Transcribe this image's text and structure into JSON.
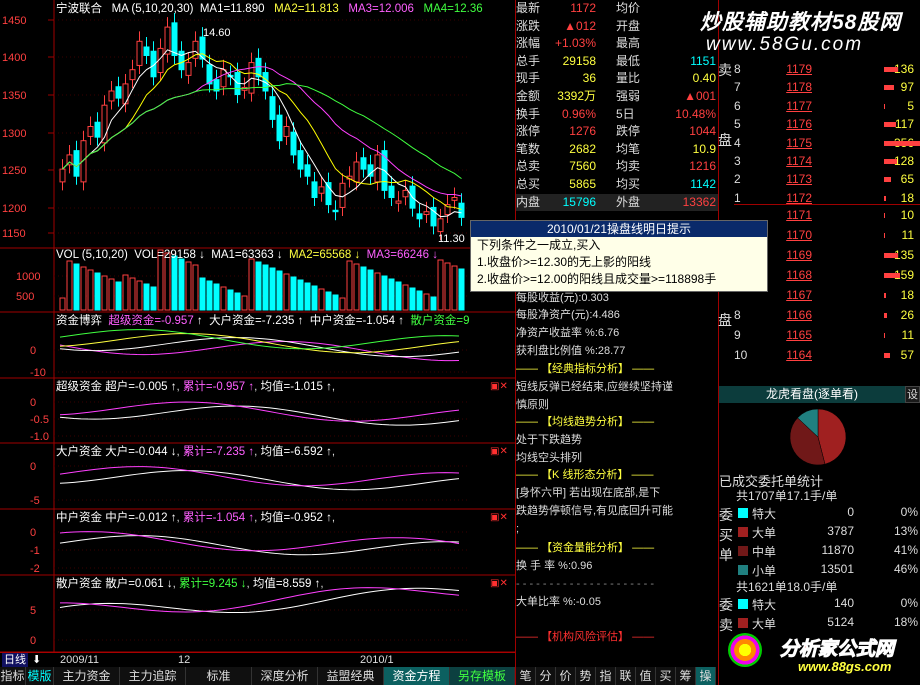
{
  "stock": {
    "name": "宁波联合"
  },
  "price_panel": {
    "ma_label": "MA (5,10,20,30)",
    "ma1": "MA1=11.890",
    "ma2": "MA2=11.813",
    "ma3": "MA3=12.006",
    "ma4": "MA4=12.36",
    "y_ticks": [
      "1450",
      "1400",
      "1350",
      "1300",
      "1250",
      "1200",
      "1150"
    ],
    "high_note": "14.60",
    "low_note": "11.30"
  },
  "volume_panel": {
    "label": "VOL (5,10,20)",
    "vol": "VOL=29158",
    "ma1": "MA1=63363",
    "ma2": "MA2=65568",
    "ma3": "MA3=66246",
    "y_ticks": [
      "1000",
      "500"
    ]
  },
  "ind1": {
    "title": "资金博弈",
    "a": "超级资金=-0.957",
    "b": "大户资金=-7.235",
    "c": "中户资金=-1.054",
    "d": "散户资金=9",
    "y_ticks": [
      "0",
      "-10"
    ]
  },
  "ind2": {
    "title": "超级资金",
    "a": "超户=-0.005",
    "b": "累计=-0.957",
    "c": "均值=-1.015",
    "y_ticks": [
      "0",
      "-0.5",
      "-1.0"
    ]
  },
  "ind3": {
    "title": "大户资金",
    "a": "大户=-0.044",
    "b": "累计=-7.235",
    "c": "均值=-6.592",
    "y_ticks": [
      "0",
      "-5"
    ]
  },
  "ind4": {
    "title": "中户资金",
    "a": "中户=-0.012",
    "b": "累计=-1.054",
    "c": "均值=-0.952",
    "y_ticks": [
      "0",
      "-1",
      "-2"
    ]
  },
  "ind5": {
    "title": "散户资金",
    "a": "散户=0.061",
    "b": "累计=9.245",
    "c": "均值=8.559",
    "y_ticks": [
      "5",
      "0"
    ]
  },
  "x_axis": {
    "labels": [
      "2009/11",
      "12",
      "2010/1"
    ],
    "period": "日线"
  },
  "quote": {
    "rows": [
      {
        "l1": "最新",
        "v1": "1172",
        "l2": "均价",
        "v2": ""
      },
      {
        "l1": "涨跌",
        "v1": "▲012",
        "l2": "开盘",
        "v2": ""
      },
      {
        "l1": "涨幅",
        "v1": "+1.03%",
        "l2": "最高",
        "v2": ""
      },
      {
        "l1": "总手",
        "v1": "29158",
        "l2": "最低",
        "v2": "1151"
      },
      {
        "l1": "现手",
        "v1": "36",
        "l2": "量比",
        "v2": "0.40"
      },
      {
        "l1": "金额",
        "v1": "3392万",
        "l2": "强弱",
        "v2": "▲001"
      },
      {
        "l1": "换手",
        "v1": "0.96%",
        "l2": "5日",
        "v2": "10.48%"
      },
      {
        "l1": "涨停",
        "v1": "1276",
        "l2": "跌停",
        "v2": "1044"
      },
      {
        "l1": "笔数",
        "v1": "2682",
        "l2": "均笔",
        "v2": "10.9"
      },
      {
        "l1": "总卖",
        "v1": "7560",
        "l2": "均卖",
        "v2": "1216"
      },
      {
        "l1": "总买",
        "v1": "5865",
        "l2": "均买",
        "v2": "1142"
      },
      {
        "l1": "内盘",
        "v1": "15796",
        "l2": "外盘",
        "v2": "13362"
      }
    ]
  },
  "watermark": {
    "top_cn": "炒股辅助教材58股网",
    "top_url": "www.58Gu.com",
    "bottom_cn": "分析家公式网",
    "bottom_url": "www.88gs.com"
  },
  "tooltip": {
    "title": "2010/01/21操盘线明日提示",
    "l1": "下列条件之一成立,买入",
    "l2": "1.收盘价>=12.30的无上影的阳线",
    "l3": "2.收盘价>=12.00的阳线且成交量>=118898手"
  },
  "fundamentals": {
    "l1": "每股收益(元):0.303",
    "l2": "每股净资产(元):4.486",
    "l3": "净资产收益率 %:6.76",
    "l4": "获利盘比例值 %:28.77",
    "h1": "【经典指标分析】",
    "t1a": "短线反弹已经结束,应继续坚持谨",
    "t1b": "慎原则",
    "h2": "【均线趋势分析】",
    "t2a": "处于下跌趋势",
    "t2b": "均线空头排列",
    "h3": "【K 线形态分析】",
    "t3a": "[身怀六甲] 若出现在底部,是下",
    "t3b": "跌趋势停顿信号,有见底回升可能",
    "t3c": ";",
    "h4": "【资金量能分析】",
    "t4a": "换 手 率 %:0.96",
    "t4b": "大单比率 %:-0.05",
    "h5": "【机构风险评估】"
  },
  "orderbook": {
    "sell_label": "卖",
    "sell_label2": "盘",
    "buy_label": "盘",
    "sells": [
      {
        "lv": "8",
        "p": "1179",
        "v": "136"
      },
      {
        "lv": "7",
        "p": "1178",
        "v": "97"
      },
      {
        "lv": "6",
        "p": "1177",
        "v": "5"
      },
      {
        "lv": "5",
        "p": "1176",
        "v": "117"
      },
      {
        "lv": "4",
        "p": "1175",
        "v": "356"
      },
      {
        "lv": "3",
        "p": "1174",
        "v": "128"
      },
      {
        "lv": "2",
        "p": "1173",
        "v": "65"
      },
      {
        "lv": "1",
        "p": "1172",
        "v": "18"
      }
    ],
    "buys": [
      {
        "lv": "",
        "p": "1171",
        "v": "10"
      },
      {
        "lv": "",
        "p": "1170",
        "v": "11"
      },
      {
        "lv": "",
        "p": "1169",
        "v": "135"
      },
      {
        "lv": "",
        "p": "1168",
        "v": "159"
      },
      {
        "lv": "",
        "p": "1167",
        "v": "18"
      },
      {
        "lv": "8",
        "p": "1166",
        "v": "26"
      },
      {
        "lv": "9",
        "p": "1165",
        "v": "11"
      },
      {
        "lv": "10",
        "p": "1164",
        "v": "57"
      }
    ]
  },
  "dragon": {
    "title": "龙虎看盘(逐单看)",
    "btn": "设"
  },
  "orders": {
    "title": "已成交委托单统计",
    "buy_header": "共1707单17.1手/单",
    "buy_side": [
      "委",
      "买",
      "单"
    ],
    "buy": [
      {
        "k": "特大",
        "n": "0",
        "p": "0%"
      },
      {
        "k": "大单",
        "n": "3787",
        "p": "13%"
      },
      {
        "k": "中单",
        "n": "11870",
        "p": "41%"
      },
      {
        "k": "小单",
        "n": "13501",
        "p": "46%"
      }
    ],
    "sell_header": "共1621单18.0手/单",
    "sell_side": [
      "委",
      "卖"
    ],
    "sell": [
      {
        "k": "特大",
        "n": "140",
        "p": "0%"
      },
      {
        "k": "大单",
        "n": "5124",
        "p": "18%"
      }
    ]
  },
  "pie": {
    "values": [
      46,
      41,
      13
    ]
  },
  "tabs": [
    "指标",
    "模版",
    "主力资金",
    "主力追踪",
    "标准",
    "深度分析",
    "益盟经典",
    "资金方程",
    "另存模板"
  ],
  "side_tabs": [
    "笔",
    "分",
    "价",
    "势",
    "指",
    "联",
    "值",
    "买",
    "筹",
    "操"
  ],
  "colors": {
    "up": "#ff4040",
    "down": "#00ffff",
    "ma1": "#ffffff",
    "ma2": "#ffff00",
    "ma3": "#ff40ff",
    "ma4": "#40ff40"
  }
}
